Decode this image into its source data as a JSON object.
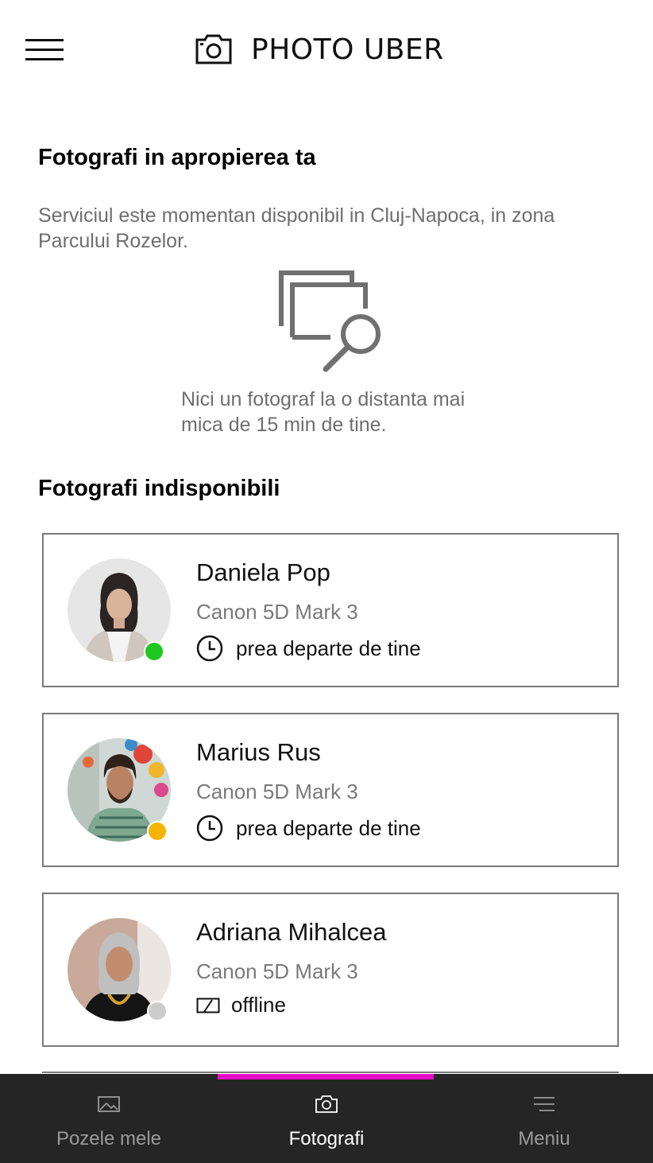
{
  "header": {
    "menu_icon": "hamburger-icon",
    "brand_icon": "camera-icon",
    "title": "PHOTO UBER"
  },
  "nearby": {
    "title": "Fotografi in apropierea ta",
    "description": "Serviciul este momentan disponibil in Cluj-Napoca, in zona Parcului Rozelor.",
    "empty_icon": "photo-search-icon",
    "empty_message": "Nici un fotograf la o distanta mai mica de 15 min de tine."
  },
  "unavailable": {
    "title": "Fotografi indisponibili",
    "photographers": [
      {
        "name": "Daniela Pop",
        "camera": "Canon 5D Mark 3",
        "status_icon": "clock-icon",
        "status_text": "prea departe de tine",
        "dot_color": "#1ec81e"
      },
      {
        "name": "Marius Rus",
        "camera": "Canon 5D Mark 3",
        "status_icon": "clock-icon",
        "status_text": "prea departe de tine",
        "dot_color": "#f5b400"
      },
      {
        "name": "Adriana Mihalcea",
        "camera": "Canon 5D Mark 3",
        "status_icon": "tablet-offline-icon",
        "status_text": "offline",
        "dot_color": "#cccccc"
      }
    ]
  },
  "bottom_nav": {
    "accent_color": "#e60ec8",
    "items": [
      {
        "label": "Pozele mele",
        "icon": "image-icon",
        "active": false
      },
      {
        "label": "Fotografi",
        "icon": "camera-icon",
        "active": true
      },
      {
        "label": "Meniu",
        "icon": "menu-lines-icon",
        "active": false
      }
    ]
  }
}
